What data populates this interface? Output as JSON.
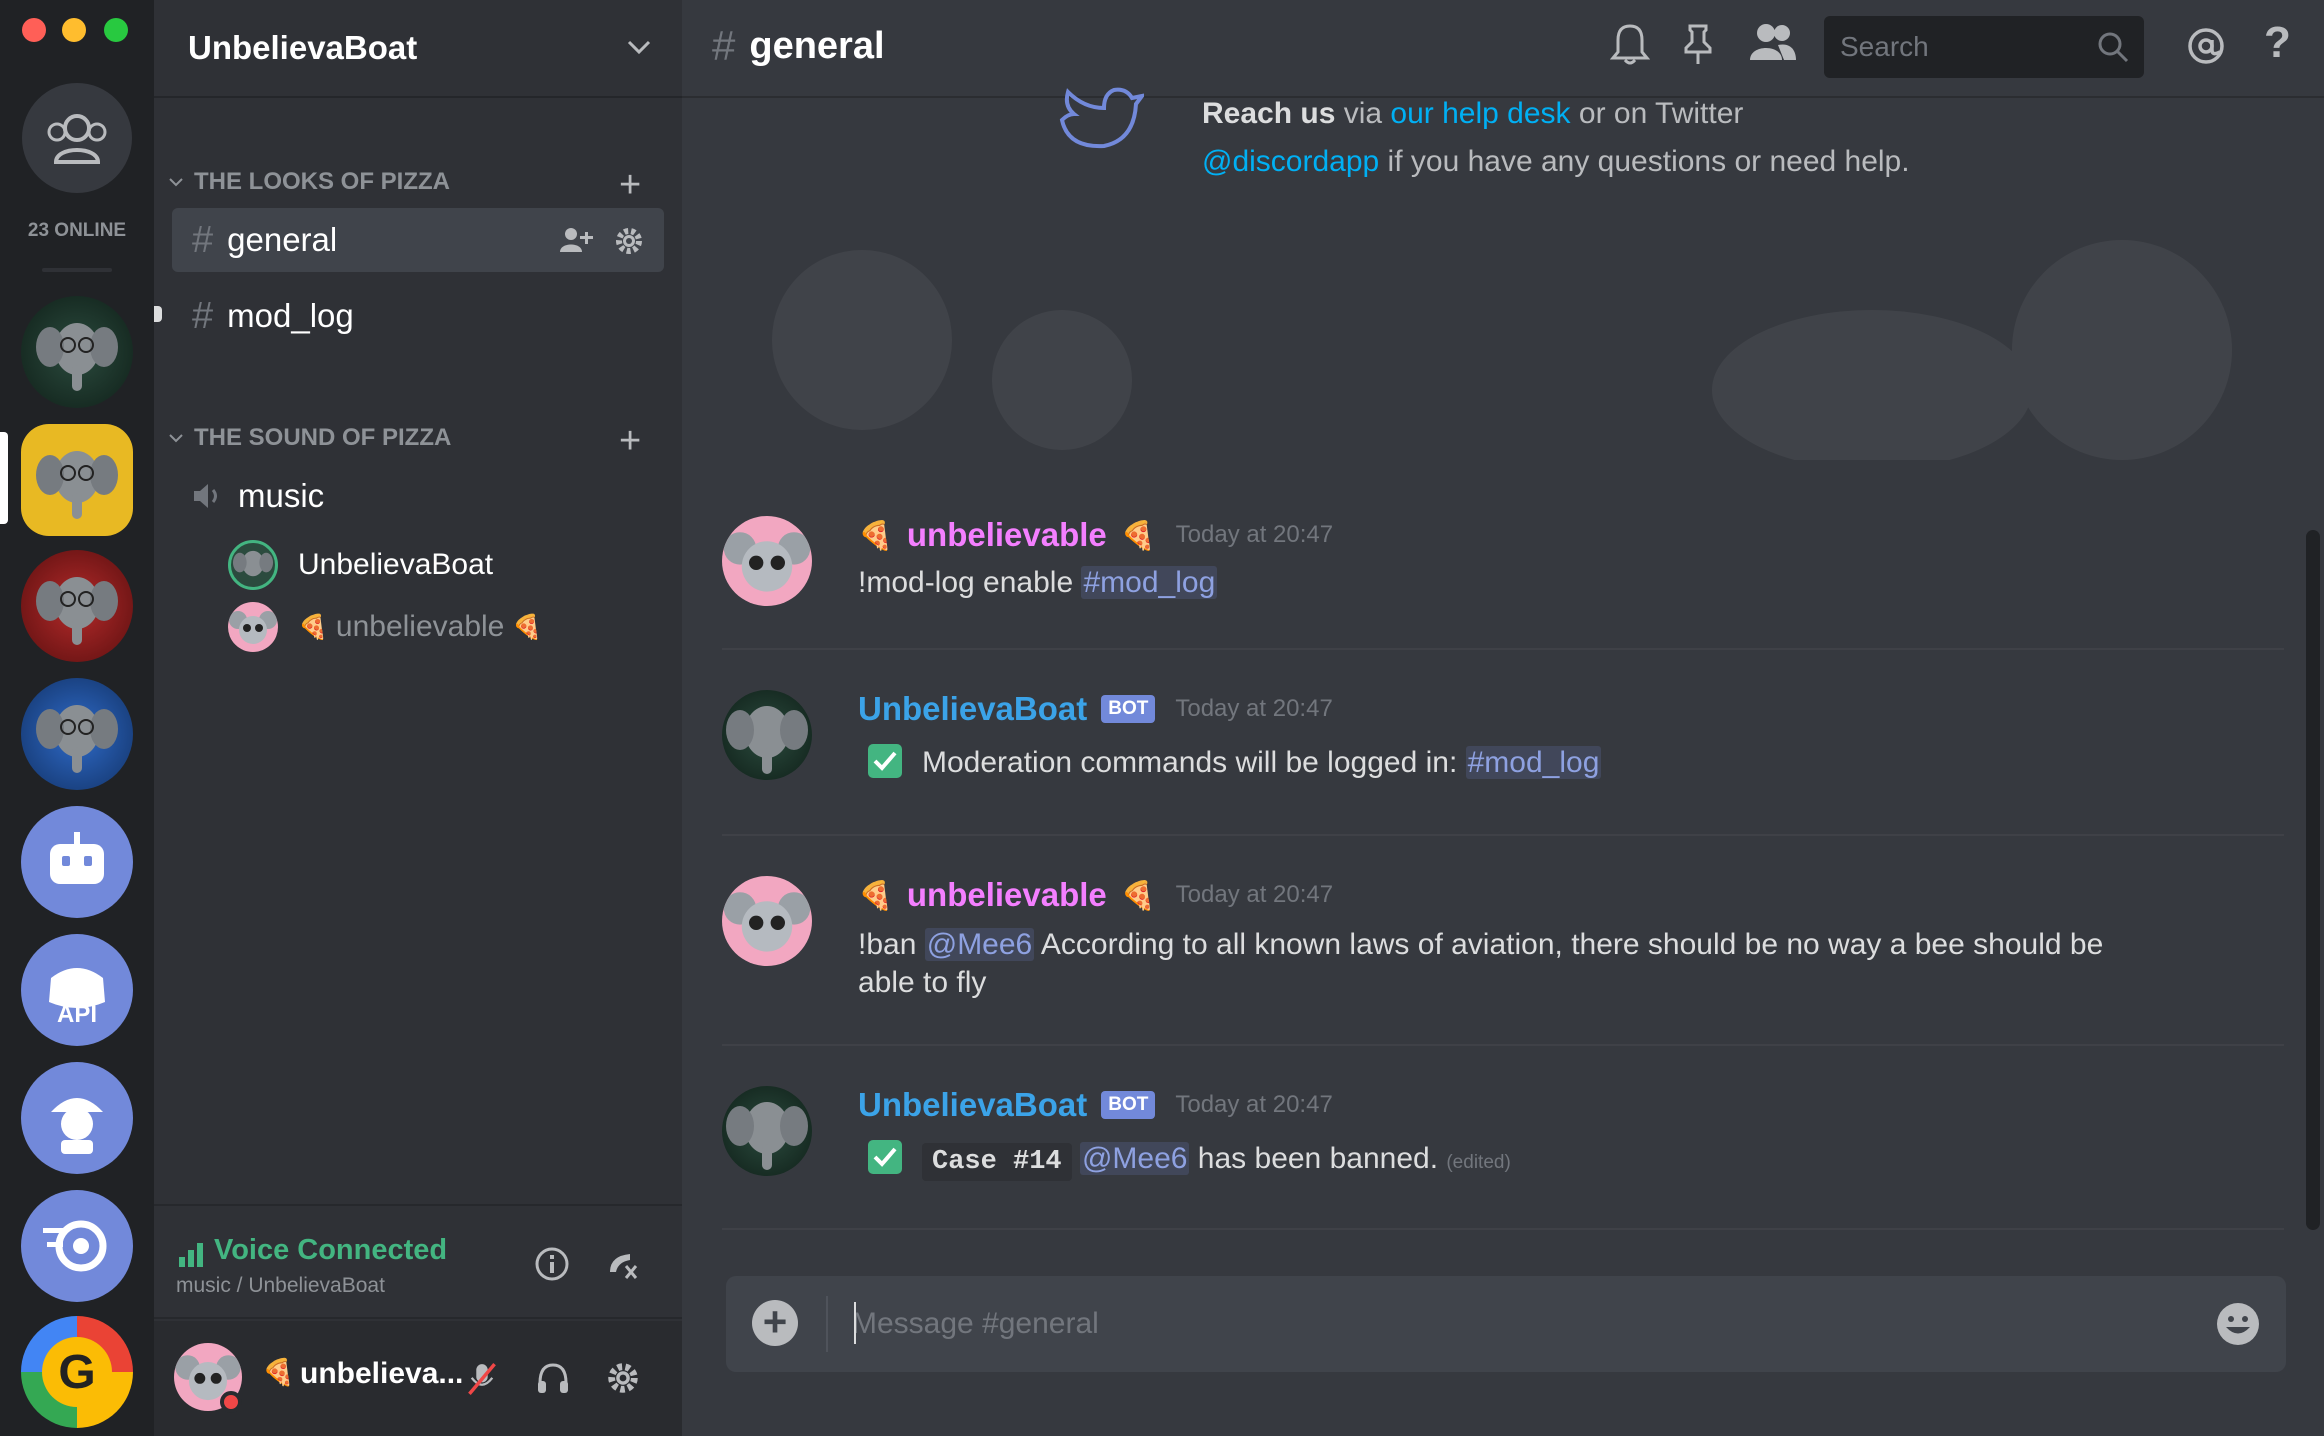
{
  "window": {
    "traffic_lights": {
      "close": "#ff5f57",
      "minimize": "#ffbd2e",
      "zoom": "#28c940"
    }
  },
  "rail": {
    "online_count": "23 ONLINE",
    "servers": [
      {
        "name": "elephant-server-green"
      },
      {
        "name": "elephant-server-yellow"
      },
      {
        "name": "elephant-server-red"
      },
      {
        "name": "elephant-server-blue"
      },
      {
        "name": "bot-server"
      },
      {
        "name": "discord-api-server"
      },
      {
        "name": "detective-server"
      },
      {
        "name": "speed-server"
      },
      {
        "name": "google-server"
      }
    ]
  },
  "guild": {
    "name": "UnbelievaBoat",
    "categories": [
      {
        "name": "THE LOOKS OF PIZZA"
      },
      {
        "name": "THE SOUND OF PIZZA"
      }
    ],
    "text_channels": [
      "general",
      "mod_log"
    ],
    "voice_channel": "music",
    "voice_users": [
      {
        "name": "UnbelievaBoat"
      },
      {
        "name": "unbelievable",
        "badge": "🍕"
      }
    ]
  },
  "voice": {
    "status": "Voice Connected",
    "location": "music / UnbelievaBoat"
  },
  "user_panel": {
    "username": "unbelieva...",
    "badge": "🍕"
  },
  "chat": {
    "channel": "general",
    "search_placeholder": "Search",
    "welcome_bold": "Reach us",
    "welcome_via": " via ",
    "welcome_link": "our help desk",
    "welcome_mid": " or on Twitter",
    "welcome_twitter": "@discordapp",
    "welcome_tail": " if you have any questions or need help.",
    "messages": [
      {
        "author": "unbelievable",
        "badge": "🍕",
        "time": "Today at 20:47",
        "text": "!mod-log enable ",
        "mention": "#mod_log"
      },
      {
        "author": "UnbelievaBoat",
        "tag": "BOT",
        "time": "Today at 20:47",
        "text": "Moderation commands will be logged in: ",
        "mention": "#mod_log"
      },
      {
        "author": "unbelievable",
        "badge": "🍕",
        "time": "Today at 20:47",
        "text_before": "!ban ",
        "mention": "@Mee6",
        "text_after": " According to all known laws of aviation, there should be no way a bee should be able to fly"
      },
      {
        "author": "UnbelievaBoat",
        "tag": "BOT",
        "time": "Today at 20:47",
        "code": "Case #14",
        "mention": "@Mee6",
        "text_after": " has been banned. ",
        "edited": "(edited)"
      }
    ],
    "composer_placeholder": "Message #general"
  },
  "colors": {
    "accent": "#7289da",
    "voice_green": "#43b581",
    "link": "#00b0f4",
    "username_pink": "#f47fff",
    "username_blue": "#3ba3e8"
  }
}
